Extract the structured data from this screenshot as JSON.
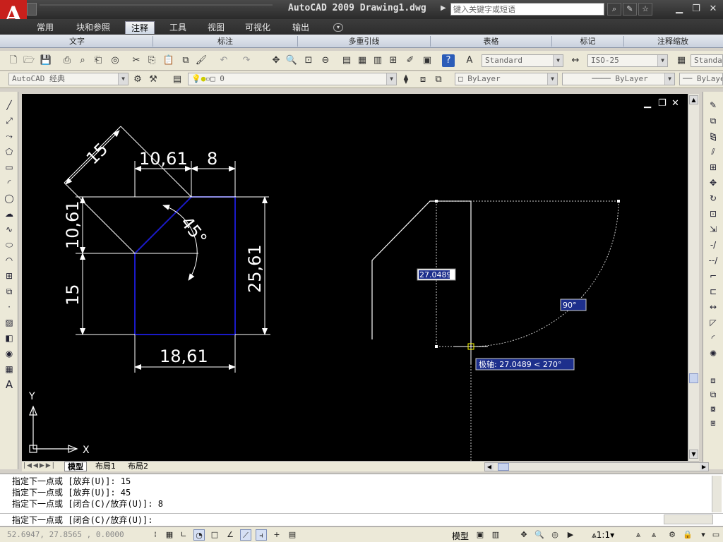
{
  "titlebar": {
    "logo_letter": "A",
    "app_title": "AutoCAD 2009 Drawing1.dwg",
    "search_placeholder": "键入关键字或短语",
    "buttons": [
      "search-icon",
      "help-icon",
      "star-icon"
    ]
  },
  "ribbon": {
    "tabs": [
      {
        "label": "常用",
        "active": false
      },
      {
        "label": "块和参照",
        "active": false
      },
      {
        "label": "注释",
        "active": true
      },
      {
        "label": "工具",
        "active": false
      },
      {
        "label": "视图",
        "active": false
      },
      {
        "label": "可视化",
        "active": false
      },
      {
        "label": "输出",
        "active": false
      }
    ],
    "panels": [
      "文字",
      "标注",
      "多重引线",
      "表格",
      "标记",
      "注释缩放"
    ]
  },
  "toolbar": {
    "text_style": "Standard",
    "dim_style": "ISO-25",
    "table_style": "Standard",
    "workspace": "AutoCAD 经典",
    "layer": "0",
    "color": "ByLayer",
    "linetype": "ByLayer",
    "lineweight": "ByLayer"
  },
  "drawing": {
    "dims": {
      "d15_diag": "15",
      "d1061_top": "10,61",
      "d8": "8",
      "d1061_left": "10,61",
      "d15_left": "15",
      "d45": "45°",
      "d2561": "25,61",
      "d1861": "18,61"
    },
    "length_input": "27.0489",
    "angle_tooltip": "90°",
    "polar_tooltip": "极轴: 27.0489 < 270°",
    "ucs_x": "X",
    "ucs_y": "Y"
  },
  "layout_tabs": [
    "模型",
    "布局1",
    "布局2"
  ],
  "command": {
    "history": [
      "指定下一点或 [放弃(U)]: 15",
      "指定下一点或 [放弃(U)]: 45",
      "指定下一点或 [闭合(C)/放弃(U)]: 8"
    ],
    "prompt": "指定下一点或 [闭合(C)/放弃(U)]:"
  },
  "status": {
    "coords": "52.6947,  27.8565 , 0.0000",
    "model_label": "模型",
    "scale": "1:1"
  },
  "colors": {
    "canvas": "#000000",
    "geometry_blue": "#1a1ac8",
    "dims_white": "#ffffff",
    "tooltip_bg": "#1d2f8c"
  }
}
